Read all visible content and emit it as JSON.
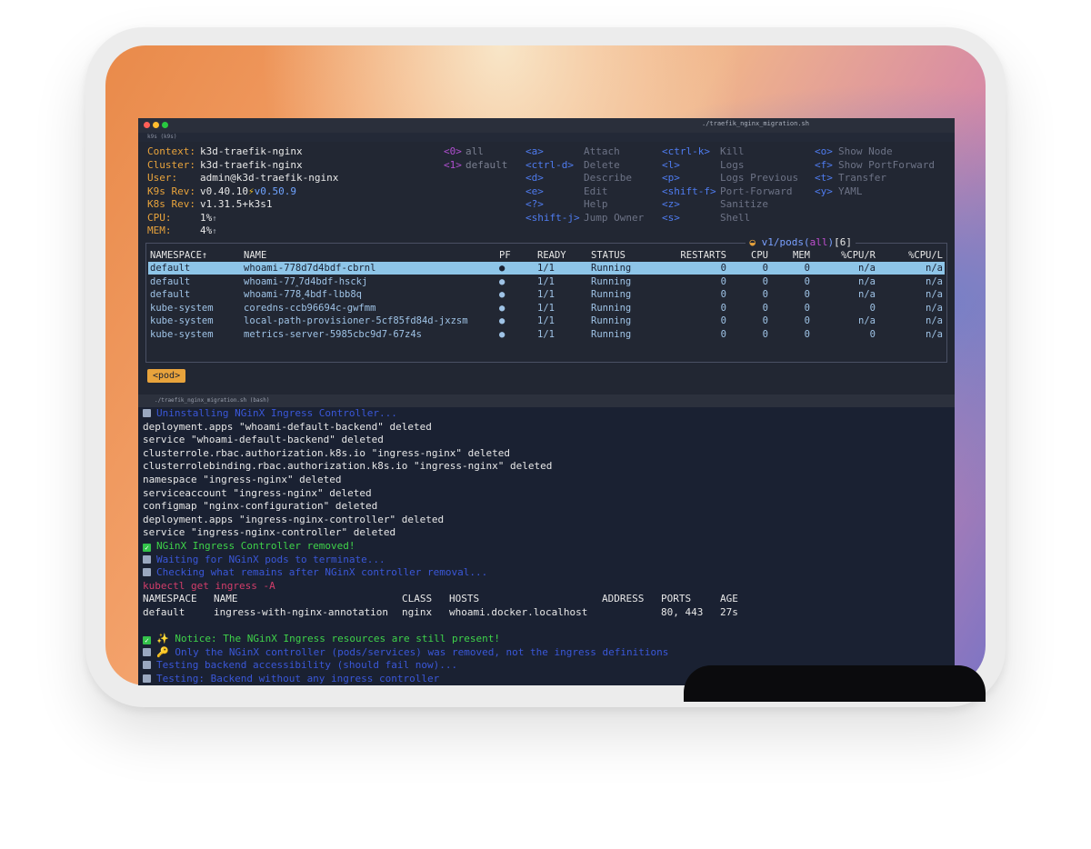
{
  "window": {
    "title": "./traefik_nginx_migration.sh",
    "tab": "k9s (k9s)"
  },
  "k9s": {
    "info": [
      {
        "label": "Context:",
        "value": "k3d-traefik-nginx"
      },
      {
        "label": "Cluster:",
        "value": "k3d-traefik-nginx"
      },
      {
        "label": "User:",
        "value": "admin@k3d-traefik-nginx"
      },
      {
        "label": "K9s Rev:",
        "value": "v0.40.10",
        "extra_icon": "⚡",
        "extra": "v0.50.9"
      },
      {
        "label": "K8s Rev:",
        "value": "v1.31.5+k3s1"
      },
      {
        "label": "CPU:",
        "value": "1%",
        "arrow": "↑"
      },
      {
        "label": "MEM:",
        "value": "4%",
        "arrow": "↑"
      }
    ],
    "namespaces": [
      {
        "key": "<0>",
        "action": "all"
      },
      {
        "key": "<1>",
        "action": "default"
      }
    ],
    "hotkeys_col1": [
      {
        "key": "<a>",
        "action": "Attach"
      },
      {
        "key": "<ctrl-d>",
        "action": "Delete"
      },
      {
        "key": "<d>",
        "action": "Describe"
      },
      {
        "key": "<e>",
        "action": "Edit"
      },
      {
        "key": "<?>",
        "action": "Help"
      },
      {
        "key": "<shift-j>",
        "action": "Jump Owner"
      }
    ],
    "hotkeys_col2": [
      {
        "key": "<ctrl-k>",
        "action": "Kill"
      },
      {
        "key": "<l>",
        "action": "Logs"
      },
      {
        "key": "<p>",
        "action": "Logs Previous"
      },
      {
        "key": "<shift-f>",
        "action": "Port-Forward"
      },
      {
        "key": "<z>",
        "action": "Sanitize"
      },
      {
        "key": "<s>",
        "action": "Shell"
      }
    ],
    "hotkeys_col3": [
      {
        "key": "<o>",
        "action": "Show Node"
      },
      {
        "key": "<f>",
        "action": "Show PortForward"
      },
      {
        "key": "<t>",
        "action": "Transfer"
      },
      {
        "key": "<y>",
        "action": "YAML"
      }
    ],
    "pods_title": {
      "prefix": "v1/pods(",
      "scope": "all",
      "suffix": ")",
      "count": "[6]"
    },
    "columns": [
      "NAMESPACE↑",
      "NAME",
      "PF",
      "READY",
      "STATUS",
      "RESTARTS",
      "CPU",
      "MEM",
      "%CPU/R",
      "%CPU/L"
    ],
    "pods": [
      {
        "namespace": "default",
        "name": "whoami-778d7d4bdf-cbrnl",
        "pf": "●",
        "ready": "1/1",
        "status": "Running",
        "restarts": "0",
        "cpu": "0",
        "mem": "0",
        "cpur": "n/a",
        "cpul": "n/a"
      },
      {
        "namespace": "default",
        "name": "whoami-77‸7d4bdf-hsckj",
        "pf": "●",
        "ready": "1/1",
        "status": "Running",
        "restarts": "0",
        "cpu": "0",
        "mem": "0",
        "cpur": "n/a",
        "cpul": "n/a"
      },
      {
        "namespace": "default",
        "name": "whoami-778‸4bdf-lbb8q",
        "pf": "●",
        "ready": "1/1",
        "status": "Running",
        "restarts": "0",
        "cpu": "0",
        "mem": "0",
        "cpur": "n/a",
        "cpul": "n/a"
      },
      {
        "namespace": "kube-system",
        "name": "coredns-ccb96694c-gwfmm",
        "pf": "●",
        "ready": "1/1",
        "status": "Running",
        "restarts": "0",
        "cpu": "0",
        "mem": "0",
        "cpur": "0",
        "cpul": "n/a"
      },
      {
        "namespace": "kube-system",
        "name": "local-path-provisioner-5cf85fd84d-jxzsm",
        "pf": "●",
        "ready": "1/1",
        "status": "Running",
        "restarts": "0",
        "cpu": "0",
        "mem": "0",
        "cpur": "n/a",
        "cpul": "n/a"
      },
      {
        "namespace": "kube-system",
        "name": "metrics-server-5985cbc9d7-67z4s",
        "pf": "●",
        "ready": "1/1",
        "status": "Running",
        "restarts": "0",
        "cpu": "0",
        "mem": "0",
        "cpur": "0",
        "cpul": "n/a"
      }
    ],
    "breadcrumb": "<pod>"
  },
  "bash_tab": "./traefik_nginx_migration.sh (bash)",
  "log": {
    "l0": "Uninstalling NGinX Ingress Controller...",
    "l1": "deployment.apps \"whoami-default-backend\" deleted",
    "l2": "service \"whoami-default-backend\" deleted",
    "l3": "clusterrole.rbac.authorization.k8s.io \"ingress-nginx\" deleted",
    "l4": "clusterrolebinding.rbac.authorization.k8s.io \"ingress-nginx\" deleted",
    "l5": "namespace \"ingress-nginx\" deleted",
    "l6": "serviceaccount \"ingress-nginx\" deleted",
    "l7": "configmap \"nginx-configuration\" deleted",
    "l8": "deployment.apps \"ingress-nginx-controller\" deleted",
    "l9": "service \"ingress-nginx-controller\" deleted",
    "l10": "NGinX Ingress Controller removed!",
    "l11": "Waiting for NGinX pods to terminate...",
    "l12": "Checking what remains after NGinX controller removal...",
    "l13": "kubectl get ingress -A",
    "l16": "✨ Notice: The NGinX Ingress resources are still present!",
    "l17": "🔑 Only the NGinX controller (pods/services) was removed, not the ingress definitions",
    "l18": "Testing backend accessibility (should fail now)...",
    "l19": "Testing: Backend without any ingress controller"
  },
  "ingress_table": {
    "headers": [
      "NAMESPACE",
      "NAME",
      "CLASS",
      "HOSTS",
      "ADDRESS",
      "PORTS",
      "AGE"
    ],
    "row": [
      "default",
      "ingress-with-nginx-annotation",
      "nginx",
      "whoami.docker.localhost",
      "",
      "80, 443",
      "27s"
    ]
  }
}
